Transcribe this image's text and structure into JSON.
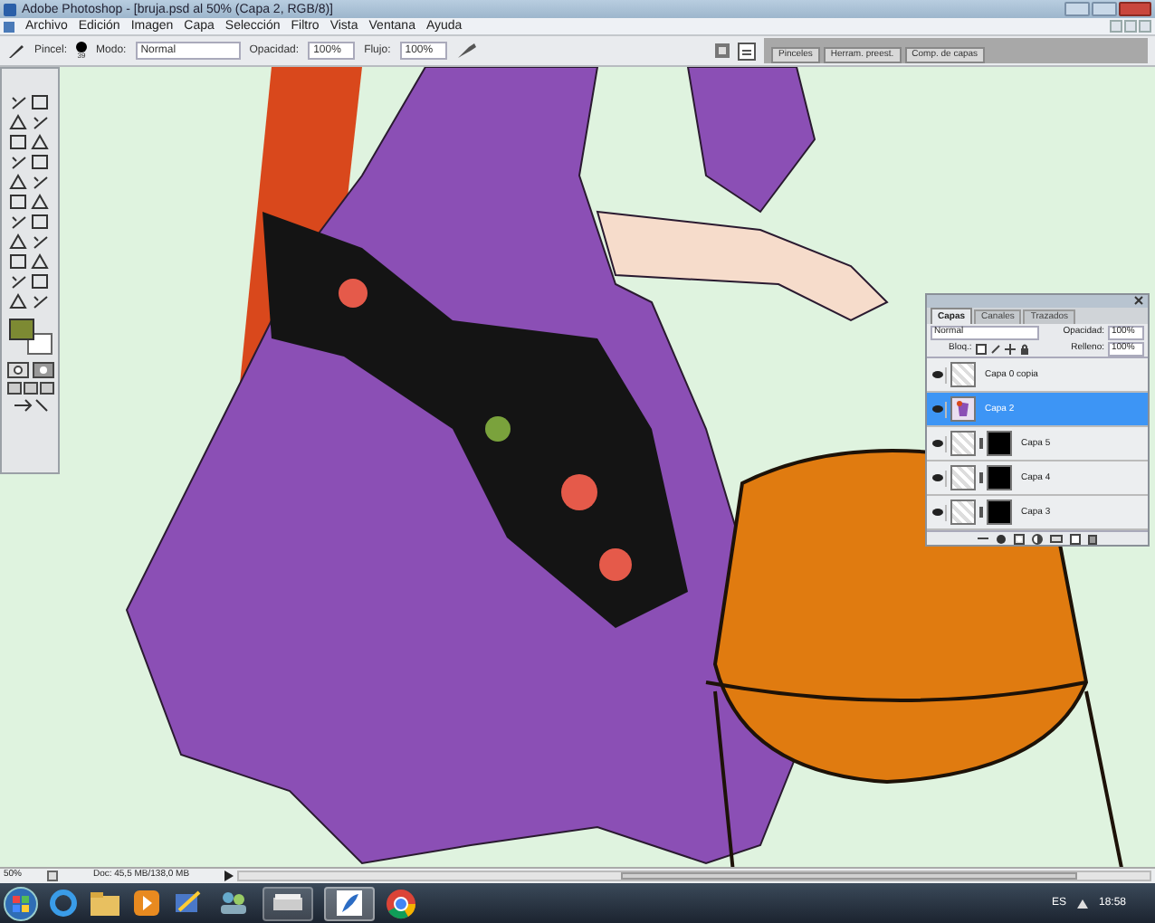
{
  "window": {
    "title": "Adobe Photoshop - [bruja.psd al 50% (Capa 2, RGB/8)]"
  },
  "menu": [
    "Archivo",
    "Edición",
    "Imagen",
    "Capa",
    "Selección",
    "Filtro",
    "Vista",
    "Ventana",
    "Ayuda"
  ],
  "options_bar": {
    "brush_label": "Pincel:",
    "brush_size": "39",
    "mode_label": "Modo:",
    "mode_value": "Normal",
    "opacity_label": "Opacidad:",
    "opacity_value": "100%",
    "flow_label": "Flujo:",
    "flow_value": "100%"
  },
  "panel_well_tabs": [
    "Pinceles",
    "Herram. preest.",
    "Comp. de capas"
  ],
  "layers_panel": {
    "tabs": [
      {
        "label": "Capas",
        "selected": true
      },
      {
        "label": "Canales",
        "selected": false
      },
      {
        "label": "Trazados",
        "selected": false
      }
    ],
    "blend_mode": "Normal",
    "opacity_label": "Opacidad:",
    "opacity_value": "100%",
    "lock_label": "Bloq.:",
    "fill_label": "Relleno:",
    "fill_value": "100%",
    "layers": [
      {
        "name": "Capa 0 copia",
        "kind": "plain",
        "visible": true,
        "selected": false
      },
      {
        "name": "Capa 2",
        "kind": "art",
        "visible": true,
        "selected": true
      },
      {
        "name": "Capa 5",
        "kind": "masked",
        "visible": true,
        "selected": false
      },
      {
        "name": "Capa 4",
        "kind": "masked",
        "visible": true,
        "selected": false
      },
      {
        "name": "Capa 3",
        "kind": "masked",
        "visible": true,
        "selected": false
      }
    ]
  },
  "status_bar": {
    "zoom": "50%",
    "doc_size": "Doc: 45,5 MB/138,0 MB"
  },
  "taskbar": {
    "language": "ES",
    "time": "18:58"
  }
}
